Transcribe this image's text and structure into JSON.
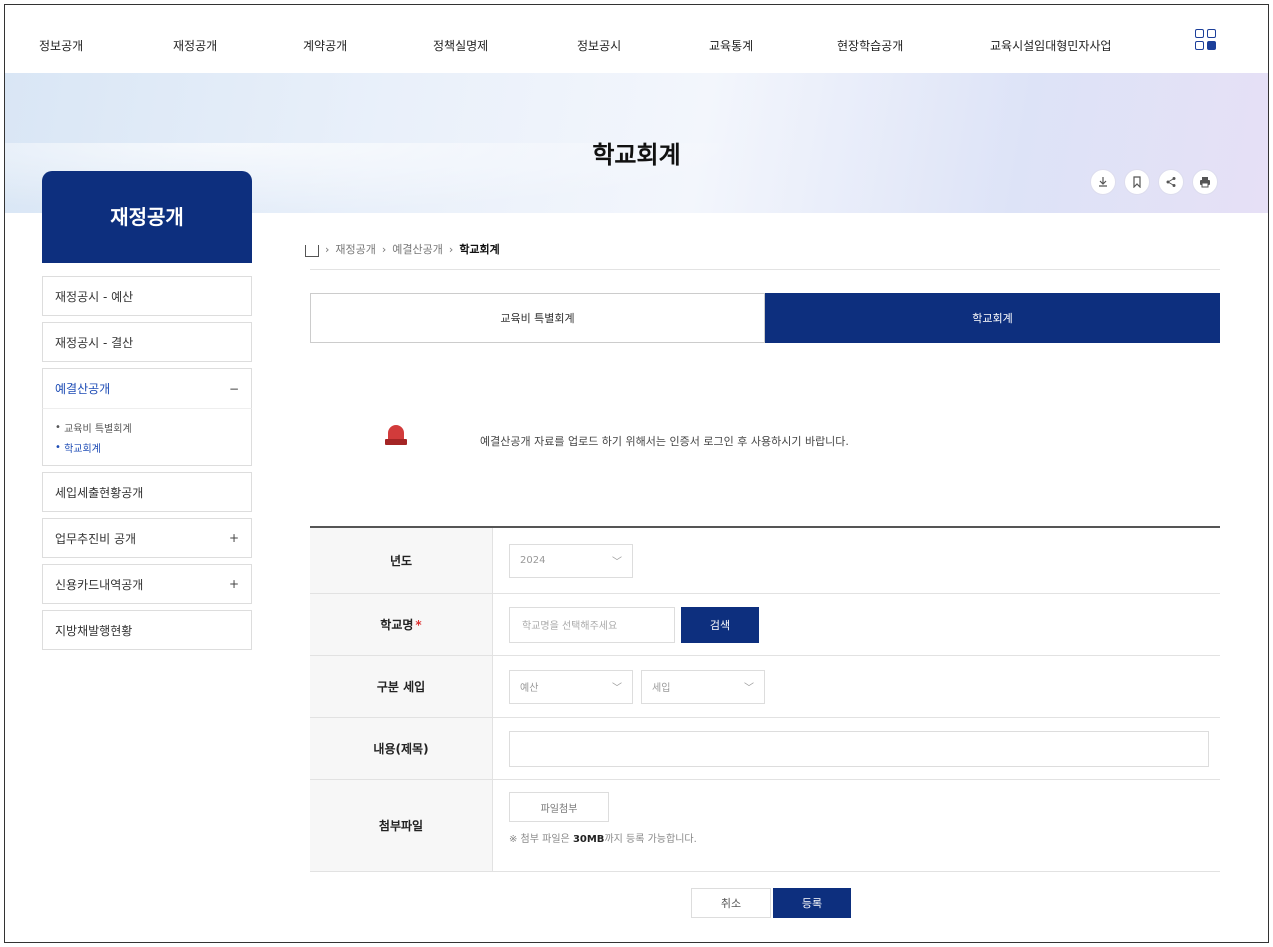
{
  "nav": {
    "items": [
      "정보공개",
      "재정공개",
      "계약공개",
      "정책실명제",
      "정보공시",
      "교육통계",
      "현장학습공개",
      "교육시설임대형민자사업"
    ],
    "apps_icon": "apps-grid-icon"
  },
  "hero": {
    "title": "학교회계",
    "tools": [
      "download-icon",
      "bookmark-icon",
      "share-icon",
      "print-icon"
    ]
  },
  "sidebar": {
    "title": "재정공개",
    "items": [
      {
        "label": "재정공시 - 예산",
        "mark": ""
      },
      {
        "label": "재정공시 - 결산",
        "mark": ""
      },
      {
        "label": "예결산공개",
        "mark": "−"
      },
      {
        "label": "세입세출현황공개",
        "mark": ""
      },
      {
        "label": "업무추진비 공개",
        "mark": "+"
      },
      {
        "label": "신용카드내역공개",
        "mark": "+"
      },
      {
        "label": "지방채발행현황",
        "mark": ""
      }
    ],
    "sub_items": [
      "교육비 특별회계",
      "학교회계"
    ]
  },
  "breadcrumb": {
    "items": [
      "재정공개",
      "예결산공개"
    ],
    "current": "학교회계",
    "separator": "›"
  },
  "tabs": [
    "교육비 특별회계",
    "학교회계"
  ],
  "notice": {
    "text": "예결산공개 자료를 업로드 하기 위해서는 인증서 로그인 후 사용하시기 바랍니다."
  },
  "form": {
    "year_label": "년도",
    "year_value": "2024",
    "school_label": "학교명",
    "school_required": "*",
    "school_placeholder": "학교명을 선택해주세요",
    "search_button": "검색",
    "category_label": "구분 세입",
    "category_value": "예산",
    "category_sub_value": "세입",
    "content_label": "내용(제목)",
    "content_value": "",
    "attach_label": "첨부파일",
    "attach_button": "파일첨부",
    "attach_hint_prefix": "※ 첨부 파일은",
    "attach_hint_size": "30MB",
    "attach_hint_suffix": "까지 등록 가능합니다."
  },
  "actions": {
    "cancel": "취소",
    "submit": "등록"
  },
  "colors": {
    "brand_navy": "#0d2f7e",
    "required_red": "#d33333"
  }
}
